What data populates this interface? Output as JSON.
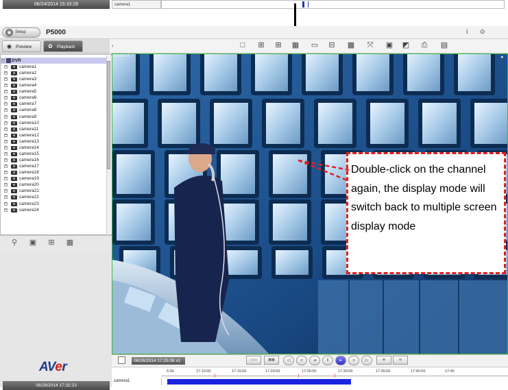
{
  "top_strip": {
    "datetime": "06/24/2014 15:33:28",
    "camera": "camera1"
  },
  "app": {
    "setup_label": "Setup",
    "model": "P5000"
  },
  "tabs": [
    {
      "label": "Preview",
      "icon": "eye-icon",
      "active": false
    },
    {
      "label": "Playback",
      "icon": "reel-icon",
      "active": true
    }
  ],
  "tree": {
    "root": "DVR",
    "cameras": [
      "camera1",
      "camera2",
      "camera3",
      "camera4",
      "camera5",
      "camera6",
      "camera7",
      "camera8",
      "camera9",
      "camera10",
      "camera11",
      "camera12",
      "camera13",
      "camera14",
      "camera15",
      "camera16",
      "camera17",
      "camera18",
      "camera19",
      "camera20",
      "camera21",
      "camera22",
      "camera23",
      "camera24"
    ]
  },
  "toolbar_icons": [
    "layout-1x1-icon",
    "layout-2x2-icon",
    "layout-3x3-icon",
    "layout-4x4-icon",
    "layout-1plus5-icon",
    "layout-1plus7-icon",
    "layout-5x5-icon",
    "fullscreen-icon",
    "snapshot-icon",
    "edit-icon",
    "print-icon",
    "export-icon"
  ],
  "tree_icons": [
    "network-icon",
    "camera-search-icon",
    "zoom-icon",
    "keyboard-icon"
  ],
  "video": {
    "camera_label": "camera1"
  },
  "callout": {
    "text": "Double-click on the channel again, the display mode will switch back to multiple screen display mode"
  },
  "logo": {
    "prefix": "AV",
    "accent": "e",
    "suffix": "r"
  },
  "bottom_date": "06/26/2014 17:32:23",
  "playback": {
    "time": "06/26/2014 17:25:08 x1",
    "buttons": [
      "step-back-icon",
      "fast-rewind-icon",
      "rewind-icon",
      "pause-icon",
      "play-icon",
      "fast-forward-icon",
      "step-forward-icon"
    ]
  },
  "timeline": {
    "ticks": [
      "5:00",
      "17:10:00",
      "17:15:00",
      "17:20:00",
      "17:25:00",
      "17:30:00",
      "17:35:00",
      "17:40:00",
      "17:45"
    ],
    "camera": "camera1"
  },
  "colors": {
    "accent": "#1a24e0",
    "callout_border": "#e02020",
    "video_border": "#3cb83c",
    "logo_blue": "#1c3a8c",
    "logo_red": "#d81818"
  }
}
